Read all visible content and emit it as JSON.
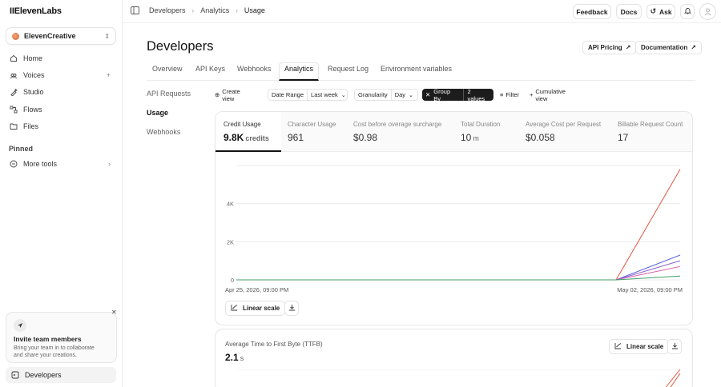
{
  "app": {
    "logo": "IIElevenLabs"
  },
  "workspace": {
    "name": "ElevenCreative"
  },
  "sidebar": {
    "items": [
      {
        "label": "Home",
        "icon": "home-icon"
      },
      {
        "label": "Voices",
        "icon": "voices-icon",
        "right": "+"
      },
      {
        "label": "Studio",
        "icon": "studio-icon"
      },
      {
        "label": "Flows",
        "icon": "flows-icon"
      },
      {
        "label": "Files",
        "icon": "files-icon"
      }
    ],
    "pinned_label": "Pinned",
    "more_tools": "More tools",
    "invite": {
      "title": "Invite team members",
      "desc_line1": "Bring your team in to collaborate",
      "desc_line2": "and share your creations."
    },
    "developers": "Developers"
  },
  "topbar": {
    "breadcrumbs": [
      "Developers",
      "Analytics",
      "Usage"
    ],
    "feedback": "Feedback",
    "docs": "Docs",
    "ask": "Ask"
  },
  "page": {
    "title": "Developers",
    "api_pricing": "API Pricing",
    "documentation": "Documentation",
    "tabs": [
      "Overview",
      "API Keys",
      "Webhooks",
      "Analytics",
      "Request Log",
      "Environment variables"
    ],
    "active_tab": "Analytics",
    "subnav": [
      "API Requests",
      "Usage",
      "Webhooks"
    ],
    "active_subnav": "Usage"
  },
  "filters": {
    "create_view": "Create view",
    "date_range_label": "Date Range",
    "date_range_value": "Last week",
    "granularity_label": "Granularity",
    "granularity_value": "Day",
    "group_by": "Group By",
    "group_by_value": "2 values",
    "filter": "Filter",
    "cumulative_view": "Cumulative view"
  },
  "metrics": [
    {
      "label": "Credit Usage",
      "value": "9.8K",
      "unit": "credits"
    },
    {
      "label": "Character Usage",
      "value": "961",
      "unit": ""
    },
    {
      "label": "Cost before overage surcharge",
      "value": "$0.98",
      "unit": ""
    },
    {
      "label": "Total Duration",
      "value": "10",
      "unit": "m"
    },
    {
      "label": "Average Cost per Request",
      "value": "$0.058",
      "unit": ""
    },
    {
      "label": "Billable Request Count",
      "value": "17",
      "unit": ""
    }
  ],
  "chart_controls": {
    "scale": "Linear scale"
  },
  "chart_data": {
    "type": "line",
    "x": [
      "Apr 25, 2026, 09:00 PM",
      "May 01, 2026, 09:00 PM",
      "May 02, 2026, 09:00 PM"
    ],
    "x_tick_labels": [
      "Apr 25, 2026, 09:00 PM",
      "May 02, 2026, 09:00 PM"
    ],
    "y_tick_labels": [
      "0",
      "2K",
      "4K"
    ],
    "ylim": [
      0,
      6000
    ],
    "series": [
      {
        "color": "#e5553f",
        "values": [
          0,
          0,
          5800
        ]
      },
      {
        "color": "#5b67e0",
        "values": [
          0,
          0,
          1300
        ]
      },
      {
        "color": "#8a63d2",
        "values": [
          0,
          0,
          1000
        ]
      },
      {
        "color": "#d45aa8",
        "values": [
          0,
          0,
          700
        ]
      },
      {
        "color": "#3fa06a",
        "values": [
          0,
          0,
          200
        ]
      }
    ],
    "grid": true
  },
  "ttfb": {
    "label": "Average Time to First Byte (TTFB)",
    "value": "2.1",
    "unit": "s",
    "scale": "Linear scale"
  }
}
